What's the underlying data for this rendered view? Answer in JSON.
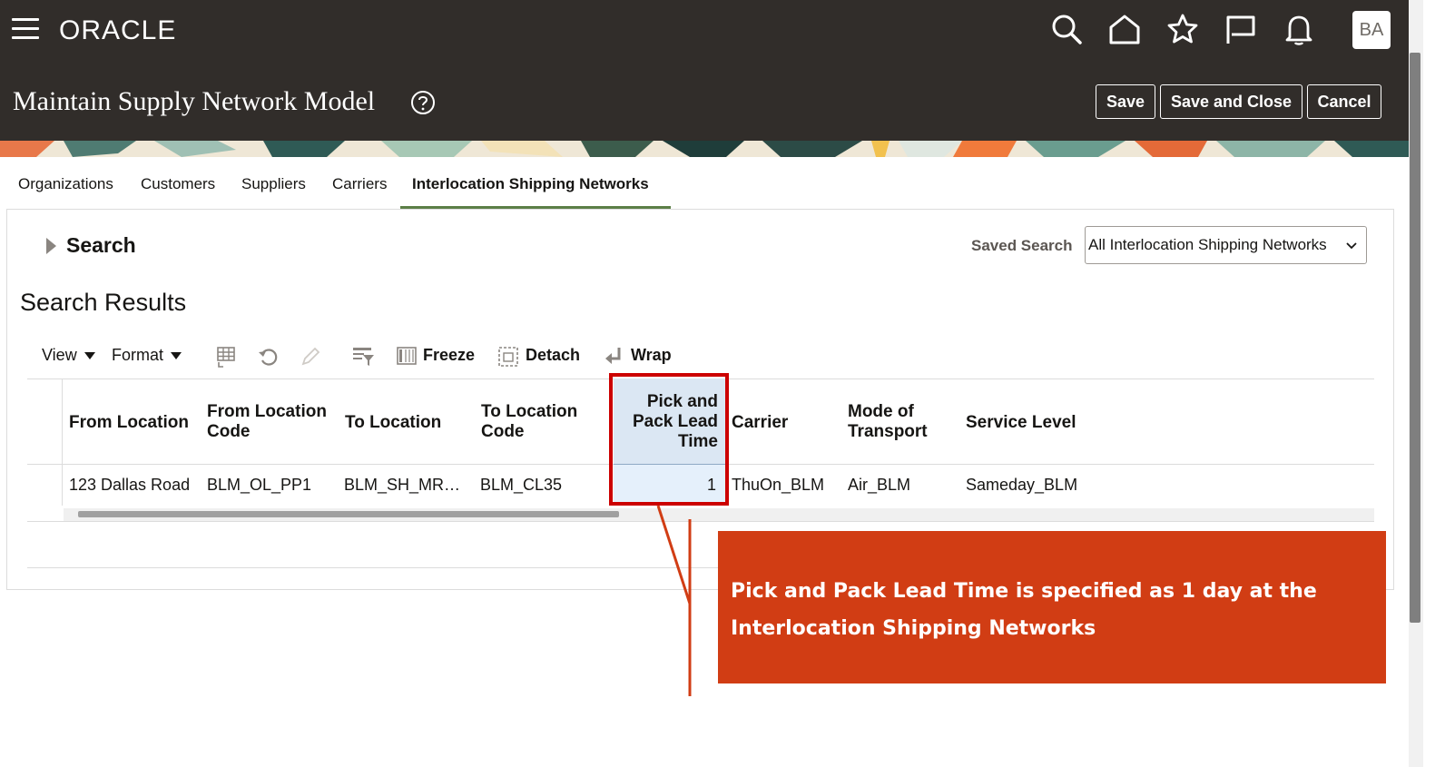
{
  "header": {
    "logo": "ORACLE",
    "avatar": "BA",
    "page_title": "Maintain Supply Network Model",
    "save_label": "Save",
    "save_close_label": "Save and Close",
    "cancel_label": "Cancel"
  },
  "tabs": [
    {
      "label": "Organizations"
    },
    {
      "label": "Customers"
    },
    {
      "label": "Suppliers"
    },
    {
      "label": "Carriers"
    },
    {
      "label": "Interlocation Shipping Networks",
      "active": true
    }
  ],
  "search": {
    "title": "Search",
    "saved_search_label": "Saved Search",
    "saved_search_value": "All Interlocation Shipping Networks"
  },
  "results": {
    "title": "Search Results",
    "toolbar": {
      "view": "View",
      "format": "Format",
      "freeze": "Freeze",
      "detach": "Detach",
      "wrap": "Wrap"
    },
    "columns": [
      {
        "label": "From Location"
      },
      {
        "label": "From Location Code"
      },
      {
        "label": "To Location"
      },
      {
        "label": "To Location Code"
      },
      {
        "label": "Pick and Pack Lead Time"
      },
      {
        "label": "Carrier"
      },
      {
        "label": "Mode of Transport"
      },
      {
        "label": "Service Level"
      }
    ],
    "rows": [
      {
        "from_location": "123 Dallas Road",
        "from_location_code": "BLM_OL_PP1",
        "to_location": "BLM_SH_MR…",
        "to_location_code": "BLM_CL35",
        "pick_pack_lead_time": "1",
        "carrier": "ThuOn_BLM",
        "mode_of_transport": "Air_BLM",
        "service_level": "Sameday_BLM"
      }
    ]
  },
  "callout": {
    "text": "Pick and Pack Lead Time is specified as 1 day at the Interlocation Shipping Networks"
  },
  "colors": {
    "topbar": "#312d2a",
    "active_tab_underline": "#5c7f47",
    "highlight": "#cc0000",
    "callout_bg": "#d13d14"
  }
}
